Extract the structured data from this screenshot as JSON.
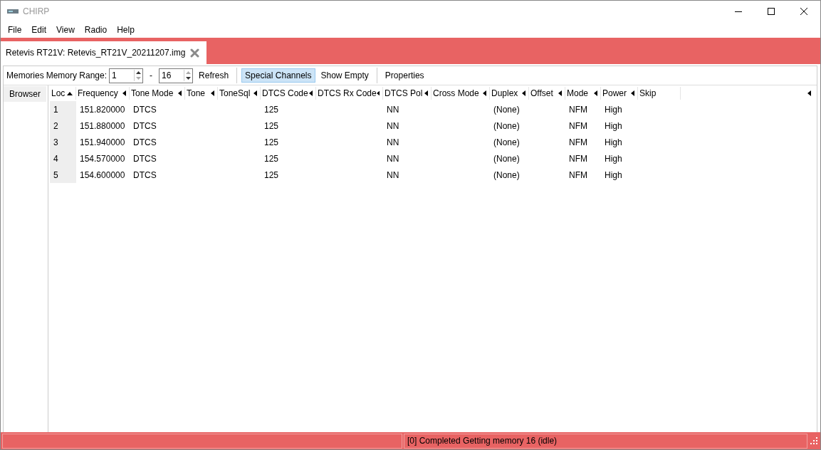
{
  "window": {
    "title": "CHIRP"
  },
  "menu": [
    "File",
    "Edit",
    "View",
    "Radio",
    "Help"
  ],
  "tabs": [
    {
      "label": "Retevis RT21V: Retevis_RT21V_20211207.img",
      "selected": true
    }
  ],
  "toolbar": {
    "section_label": "Memories",
    "range_label": "Memory Range:",
    "range_from": "1",
    "range_separator": "-",
    "range_to": "16",
    "refresh": "Refresh",
    "toggles": [
      {
        "label": "Special Channels",
        "selected": true
      },
      {
        "label": "Show Empty",
        "selected": false
      }
    ],
    "properties": "Properties"
  },
  "side_tabs": [
    {
      "label": "Browser",
      "selected": false
    }
  ],
  "table": {
    "columns": [
      {
        "label": "Loc",
        "sorted": true
      },
      {
        "label": "Frequency",
        "sorted": false
      },
      {
        "label": "Tone Mode",
        "sorted": false
      },
      {
        "label": "Tone",
        "sorted": false
      },
      {
        "label": "ToneSql",
        "sorted": false
      },
      {
        "label": "DTCS Code",
        "sorted": false
      },
      {
        "label": "DTCS Rx Code",
        "sorted": false
      },
      {
        "label": "DTCS Pol",
        "sorted": false
      },
      {
        "label": "Cross Mode",
        "sorted": false
      },
      {
        "label": "Duplex",
        "sorted": false
      },
      {
        "label": "Offset",
        "sorted": false
      },
      {
        "label": "Mode",
        "sorted": false
      },
      {
        "label": "Power",
        "sorted": false
      },
      {
        "label": "Skip",
        "sorted": false
      }
    ],
    "rows": [
      [
        "1",
        "151.820000",
        "DTCS",
        null,
        null,
        "125",
        null,
        "NN",
        null,
        "(None)",
        null,
        "NFM",
        "High",
        null
      ],
      [
        "2",
        "151.880000",
        "DTCS",
        null,
        null,
        "125",
        null,
        "NN",
        null,
        "(None)",
        null,
        "NFM",
        "High",
        null
      ],
      [
        "3",
        "151.940000",
        "DTCS",
        null,
        null,
        "125",
        null,
        "NN",
        null,
        "(None)",
        null,
        "NFM",
        "High",
        null
      ],
      [
        "4",
        "154.570000",
        "DTCS",
        null,
        null,
        "125",
        null,
        "NN",
        null,
        "(None)",
        null,
        "NFM",
        "High",
        null
      ],
      [
        "5",
        "154.600000",
        "DTCS",
        null,
        null,
        "125",
        null,
        "NN",
        null,
        "(None)",
        null,
        "NFM",
        "High",
        null
      ]
    ]
  },
  "status_bar": {
    "message": "[0] Completed Getting memory 16 (idle)"
  }
}
